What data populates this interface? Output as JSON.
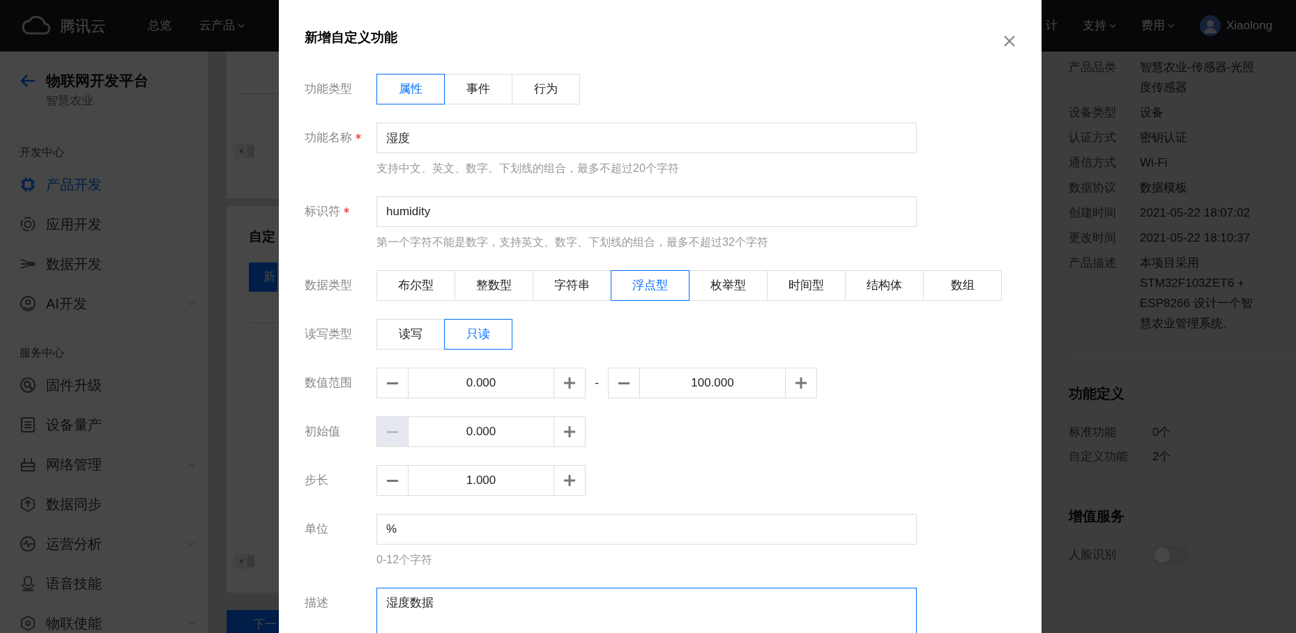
{
  "topbar": {
    "logo": "腾讯云",
    "nav": [
      {
        "label": "总览",
        "dropdown": false
      },
      {
        "label": "云产品",
        "dropdown": true
      }
    ],
    "right_nav": [
      {
        "label": "计",
        "dropdown": false
      },
      {
        "label": "支持",
        "dropdown": true
      },
      {
        "label": "费用",
        "dropdown": true
      }
    ],
    "user": "Xiaolong"
  },
  "sidebar": {
    "title": "物联网开发平台",
    "subtitle": "智慧农业",
    "sections": [
      {
        "heading": "开发中心",
        "items": [
          {
            "label": "产品开发",
            "selected": true,
            "expandable": false
          },
          {
            "label": "应用开发",
            "selected": false,
            "expandable": false
          },
          {
            "label": "数据开发",
            "selected": false,
            "expandable": false
          },
          {
            "label": "AI开发",
            "selected": false,
            "expandable": true
          }
        ]
      },
      {
        "heading": "服务中心",
        "items": [
          {
            "label": "固件升级",
            "selected": false,
            "expandable": false
          },
          {
            "label": "设备量产",
            "selected": false,
            "expandable": false
          },
          {
            "label": "网络管理",
            "selected": false,
            "expandable": true
          },
          {
            "label": "数据同步",
            "selected": false,
            "expandable": false
          },
          {
            "label": "运营分析",
            "selected": false,
            "expandable": true
          },
          {
            "label": "语音技能",
            "selected": false,
            "expandable": false
          },
          {
            "label": "物联使能",
            "selected": false,
            "expandable": true
          }
        ]
      }
    ]
  },
  "main": {
    "heading": "自定",
    "primary_button": "新",
    "next_button": "下一"
  },
  "details": {
    "rows": [
      {
        "label": "产品品类",
        "value": "智慧农业-传感器-光照度传感器"
      },
      {
        "label": "设备类型",
        "value": "设备"
      },
      {
        "label": "认证方式",
        "value": "密钥认证"
      },
      {
        "label": "通信方式",
        "value": "Wi-Fi"
      },
      {
        "label": "数据协议",
        "value": "数据模板"
      },
      {
        "label": "创建时间",
        "value": "2021-05-22 18:07:02"
      },
      {
        "label": "更改时间",
        "value": "2021-05-22 18:10:37"
      },
      {
        "label": "产品描述",
        "value": "本项目采用 STM32F103ZET6 + ESP8266 设计一个智慧农业管理系统。"
      }
    ],
    "functions": {
      "title": "功能定义",
      "rows": [
        {
          "label": "标准功能",
          "value": "0个"
        },
        {
          "label": "自定义功能",
          "value": "2个"
        }
      ]
    },
    "services": {
      "title": "增值服务",
      "rows": [
        {
          "label": "人脸识别",
          "on": false
        }
      ]
    }
  },
  "dialog": {
    "title": "新增自定义功能",
    "fields": [
      {
        "kind": "segmented",
        "label": "功能类型",
        "required": false,
        "options": [
          {
            "label": "属性",
            "selected": true
          },
          {
            "label": "事件",
            "selected": false
          },
          {
            "label": "行为",
            "selected": false
          }
        ]
      },
      {
        "kind": "text",
        "label": "功能名称",
        "required": true,
        "value": "湿度",
        "hint": "支持中文、英文、数字、下划线的组合，最多不超过20个字符"
      },
      {
        "kind": "text",
        "label": "标识符",
        "required": true,
        "value": "humidity",
        "hint": "第一个字符不能是数字，支持英文、数字、下划线的组合，最多不超过32个字符"
      },
      {
        "kind": "segmented",
        "label": "数据类型",
        "required": false,
        "options": [
          {
            "label": "布尔型",
            "selected": false
          },
          {
            "label": "整数型",
            "selected": false
          },
          {
            "label": "字符串",
            "selected": false
          },
          {
            "label": "浮点型",
            "selected": true
          },
          {
            "label": "枚举型",
            "selected": false
          },
          {
            "label": "时间型",
            "selected": false
          },
          {
            "label": "结构体",
            "selected": false
          },
          {
            "label": "数组",
            "selected": false
          }
        ]
      },
      {
        "kind": "segmented",
        "label": "读写类型",
        "required": false,
        "options": [
          {
            "label": "读写",
            "selected": false
          },
          {
            "label": "只读",
            "selected": true
          }
        ]
      },
      {
        "kind": "stepper",
        "label": "数值范围",
        "required": false,
        "separator": "-",
        "steppers": [
          {
            "value": "0.000",
            "decrement_disabled": false
          },
          {
            "value": "100.000",
            "decrement_disabled": false
          }
        ]
      },
      {
        "kind": "stepper",
        "label": "初始值",
        "required": false,
        "steppers": [
          {
            "value": "0.000",
            "decrement_disabled": true
          }
        ]
      },
      {
        "kind": "stepper",
        "label": "步长",
        "required": false,
        "steppers": [
          {
            "value": "1.000",
            "decrement_disabled": false
          }
        ]
      },
      {
        "kind": "text",
        "label": "单位",
        "required": false,
        "value": "%",
        "hint": "0-12个字符"
      },
      {
        "kind": "textarea",
        "label": "描述",
        "required": false,
        "value": "湿度数据",
        "focused": true
      }
    ]
  }
}
